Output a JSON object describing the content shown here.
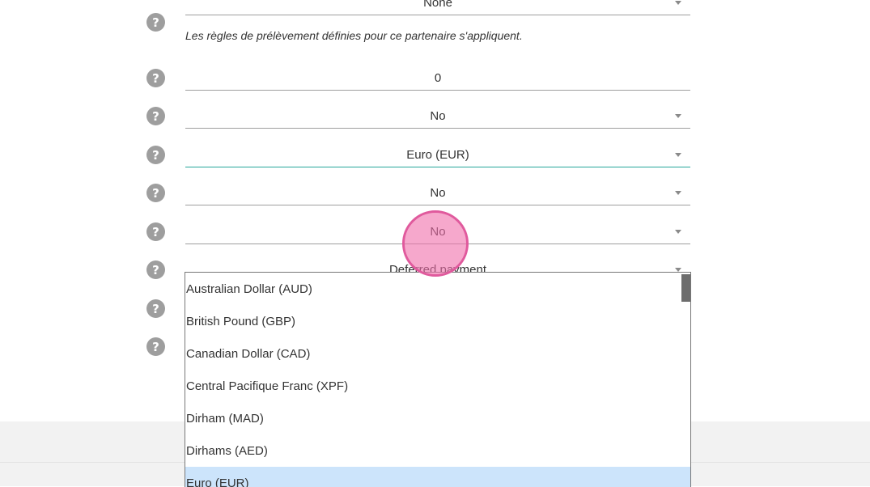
{
  "form": {
    "rows": [
      {
        "value": "None",
        "type": "select"
      },
      {
        "value": "0",
        "type": "number"
      },
      {
        "value": "No",
        "type": "select"
      },
      {
        "value": "Euro (EUR)",
        "type": "select"
      },
      {
        "value": "No",
        "type": "select"
      },
      {
        "value": "No",
        "type": "select"
      },
      {
        "value": "Deferred payment",
        "type": "select"
      }
    ],
    "note": "Les règles de prélèvement définies pour ce partenaire s'appliquent.",
    "help_glyph": "?"
  },
  "dropdown": {
    "options": [
      "Australian Dollar (AUD)",
      "British Pound (GBP)",
      "Canadian Dollar (CAD)",
      "Central Pacifique Franc (XPF)",
      "Dirham (MAD)",
      "Dirhams (AED)",
      "Euro (EUR)"
    ],
    "selected": "Euro (EUR)"
  },
  "colors": {
    "active_underline": "#26a69a",
    "selected_option_bg": "#cce4fb",
    "touch_indicator": "#e05a9d"
  }
}
